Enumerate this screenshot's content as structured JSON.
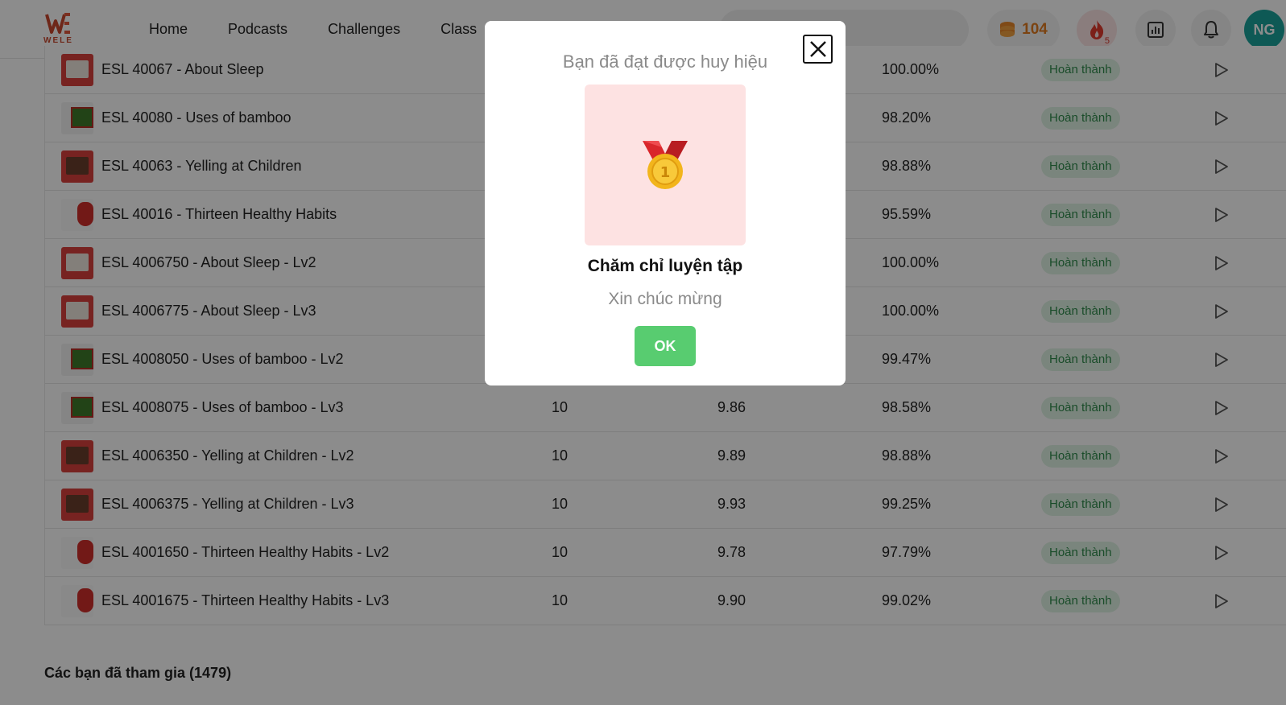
{
  "header": {
    "logo_text": "WELE",
    "nav": [
      "Home",
      "Podcasts",
      "Challenges",
      "Class"
    ],
    "coins": "104",
    "streak_count": "5",
    "avatar_initials": "NG",
    "accent": "#58cc70"
  },
  "rows": [
    {
      "title": "ESL 40067 - About Sleep",
      "thumb": "sleep",
      "c1": "",
      "c2": "",
      "c3": "100.00%",
      "status": "Hoàn thành"
    },
    {
      "title": "ESL 40080 - Uses of bamboo",
      "thumb": "bamboo",
      "c1": "",
      "c2": "",
      "c3": "98.20%",
      "status": "Hoàn thành"
    },
    {
      "title": "ESL 40063 - Yelling at Children",
      "thumb": "yell",
      "c1": "",
      "c2": "",
      "c3": "98.88%",
      "status": "Hoàn thành"
    },
    {
      "title": "ESL 40016 - Thirteen Healthy Habits",
      "thumb": "habits",
      "c1": "",
      "c2": "",
      "c3": "95.59%",
      "status": "Hoàn thành"
    },
    {
      "title": "ESL 4006750 - About Sleep - Lv2",
      "thumb": "sleep",
      "c1": "",
      "c2": "",
      "c3": "100.00%",
      "status": "Hoàn thành"
    },
    {
      "title": "ESL 4006775 - About Sleep - Lv3",
      "thumb": "sleep",
      "c1": "",
      "c2": "",
      "c3": "100.00%",
      "status": "Hoàn thành"
    },
    {
      "title": "ESL 4008050 - Uses of bamboo - Lv2",
      "thumb": "bamboo",
      "c1": "",
      "c2": "",
      "c3": "99.47%",
      "status": "Hoàn thành"
    },
    {
      "title": "ESL 4008075 - Uses of bamboo - Lv3",
      "thumb": "bamboo",
      "c1": "10",
      "c2": "9.86",
      "c3": "98.58%",
      "status": "Hoàn thành"
    },
    {
      "title": "ESL 4006350 - Yelling at Children - Lv2",
      "thumb": "yell",
      "c1": "10",
      "c2": "9.89",
      "c3": "98.88%",
      "status": "Hoàn thành"
    },
    {
      "title": "ESL 4006375 - Yelling at Children - Lv3",
      "thumb": "yell",
      "c1": "10",
      "c2": "9.93",
      "c3": "99.25%",
      "status": "Hoàn thành"
    },
    {
      "title": "ESL 4001650 - Thirteen Healthy Habits - Lv2",
      "thumb": "habits",
      "c1": "10",
      "c2": "9.78",
      "c3": "97.79%",
      "status": "Hoàn thành"
    },
    {
      "title": "ESL 4001675 - Thirteen Healthy Habits - Lv3",
      "thumb": "habits",
      "c1": "10",
      "c2": "9.90",
      "c3": "99.02%",
      "status": "Hoàn thành"
    }
  ],
  "joined_label": "Các bạn đã tham gia (1479)",
  "modal": {
    "heading": "Bạn đã đạt được huy hiệu",
    "badge_name": "Chăm chỉ luyện tập",
    "congrats": "Xin chúc mừng",
    "ok_label": "OK",
    "medal_number": "1",
    "medal_icon": "gold-medal-icon",
    "close_icon": "close-icon"
  }
}
